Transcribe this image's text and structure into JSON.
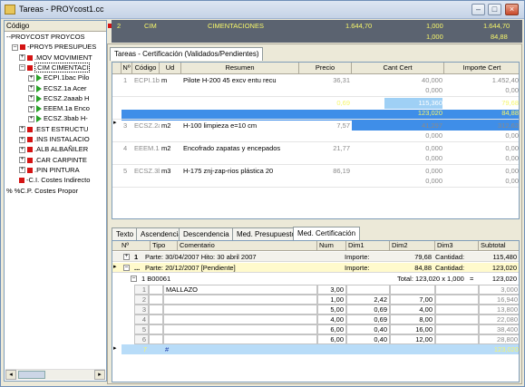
{
  "window": {
    "title": "Tareas - PROYcost1.cc",
    "buttons": {
      "minimize": "–",
      "maximize": "□",
      "close": "×"
    }
  },
  "tree": {
    "header": "Código",
    "items": [
      {
        "expander": "",
        "marker": "none",
        "label": "--PROYCOST  PROYCOS"
      },
      {
        "expander": "–",
        "marker": "red",
        "label": "-PROY5  PRESUPUES"
      },
      {
        "expander": "+",
        "marker": "red",
        "label": ".MOV  MOVIMIENT"
      },
      {
        "expander": "–",
        "marker": "red",
        "label": ".CIM  CIMENTACI"
      },
      {
        "expander": "+",
        "marker": "green",
        "label": "ECPI.1bac  Pilo"
      },
      {
        "expander": "+",
        "marker": "green",
        "label": "ECSZ.1a  Acer"
      },
      {
        "expander": "+",
        "marker": "green",
        "label": "ECSZ.2aaab  H"
      },
      {
        "expander": "+",
        "marker": "green",
        "label": "EEEM.1a  Enco"
      },
      {
        "expander": "+",
        "marker": "green",
        "label": "ECSZ.3bab  H-"
      },
      {
        "expander": "+",
        "marker": "red",
        "label": ".EST  ESTRUCTU"
      },
      {
        "expander": "+",
        "marker": "red",
        "label": ".INS  INSTALACIO"
      },
      {
        "expander": "+",
        "marker": "red",
        "label": ".ALB  ALBAÑILER"
      },
      {
        "expander": "+",
        "marker": "red",
        "label": ".CAR  CARPINTE"
      },
      {
        "expander": "+",
        "marker": "red",
        "label": ".PIN  PINTURA"
      },
      {
        "expander": "",
        "marker": "red",
        "label": "-C.I.  Costes Indirecto"
      },
      {
        "expander": "",
        "marker": "none",
        "label": "% %C.P.  Costes Propor"
      }
    ]
  },
  "top_strip": {
    "num": "2",
    "code": "CIM",
    "desc": "CIMENTACIONES",
    "v1": "1.644,70",
    "v2": "1,000",
    "v3": "1.644,70",
    "v4": "1,000",
    "v5": "84,88"
  },
  "cert": {
    "tab": "Tareas - Certificación (Validados/Pendientes)",
    "headers": [
      "Nº",
      "Código",
      "Ud",
      "Resumen",
      "Precio",
      "Cant Cert",
      "Importe Cert"
    ],
    "rows": [
      {
        "n": "1",
        "code": "ECPI.1bac",
        "ud": "m",
        "summary": "Pilote H-200 45 excv entu recu",
        "price": "36,31",
        "cant": "40,000",
        "imp": "1.452,40",
        "cant2": "0,000",
        "imp2": "0,00"
      },
      {
        "n": "2",
        "code": "ECSZ.1a",
        "ud": "kg",
        "summary": "Acero ME corrugado",
        "price": "0,69",
        "cant": "115,360",
        "imp": "79,68",
        "cant2": "123,020",
        "imp2": "84,88"
      },
      {
        "n": "3",
        "code": "ECSZ.2aaab",
        "ud": "m2",
        "summary": "H-100 limpieza e=10 cm",
        "price": "7,57",
        "cant": "41,297",
        "imp": "312,62",
        "cant2": "0,000",
        "imp2": "0,00"
      },
      {
        "n": "4",
        "code": "EEEM.1a",
        "ud": "m2",
        "summary": "Encofrado zapatas y encepados",
        "price": "21,77",
        "cant": "0,000",
        "imp": "0,00",
        "cant2": "0,000",
        "imp2": "0,00"
      },
      {
        "n": "5",
        "code": "ECSZ.3bab",
        "ud": "m3",
        "summary": "H-175 znj-zap-rios plástica 20",
        "price": "86,19",
        "cant": "0,000",
        "imp": "0,00",
        "cant2": "0,000",
        "imp2": "0,00"
      }
    ]
  },
  "subtabs": [
    "Texto",
    "Ascendencia",
    "Descendencia",
    "Med. Presupuesto",
    "Med. Certificación"
  ],
  "med": {
    "headers": [
      "Nº",
      "Tipo",
      "Comentario",
      "Num",
      "Dim1",
      "Dim2",
      "Dim3",
      "Subtotal"
    ],
    "parte1": {
      "expander": "+",
      "n": "1",
      "text": "Parte: 30/04/2007   Hito: 30 abril 2007",
      "imp_label": "Importe:",
      "imp": "79,68",
      "cant_label": "Cantidad:",
      "cant": "115,480"
    },
    "parte2": {
      "expander": "–",
      "n": "...",
      "text": "Parte: 20/12/2007 [Pendiente]",
      "imp_label": "Importe:",
      "imp": "84,88",
      "cant_label": "Cantidad:",
      "cant": "123,020"
    },
    "group": {
      "expander": "–",
      "label": "1 B00061",
      "total": "Total: 123,020 x 1,000",
      "eq": "=",
      "value": "123,020"
    },
    "lines": [
      {
        "n": "1",
        "comment": "MALLAZO",
        "num": "3,00",
        "d1": "",
        "d2": "",
        "d3": "",
        "sub": "3,000"
      },
      {
        "n": "2",
        "comment": "",
        "num": "1,00",
        "d1": "2,42",
        "d2": "7,00",
        "d3": "",
        "sub": "16,940"
      },
      {
        "n": "3",
        "comment": "",
        "num": "5,00",
        "d1": "0,69",
        "d2": "4,00",
        "d3": "",
        "sub": "13,800"
      },
      {
        "n": "4",
        "comment": "",
        "num": "4,00",
        "d1": "0,69",
        "d2": "8,00",
        "d3": "",
        "sub": "22,080"
      },
      {
        "n": "5",
        "comment": "",
        "num": "6,00",
        "d1": "0,40",
        "d2": "16,00",
        "d3": "",
        "sub": "38,400"
      },
      {
        "n": "6",
        "comment": "",
        "num": "6,00",
        "d1": "0,40",
        "d2": "12,00",
        "d3": "",
        "sub": "28,800"
      }
    ],
    "new_row": {
      "n": "7",
      "tipo": "#",
      "sub": "123,020"
    }
  }
}
